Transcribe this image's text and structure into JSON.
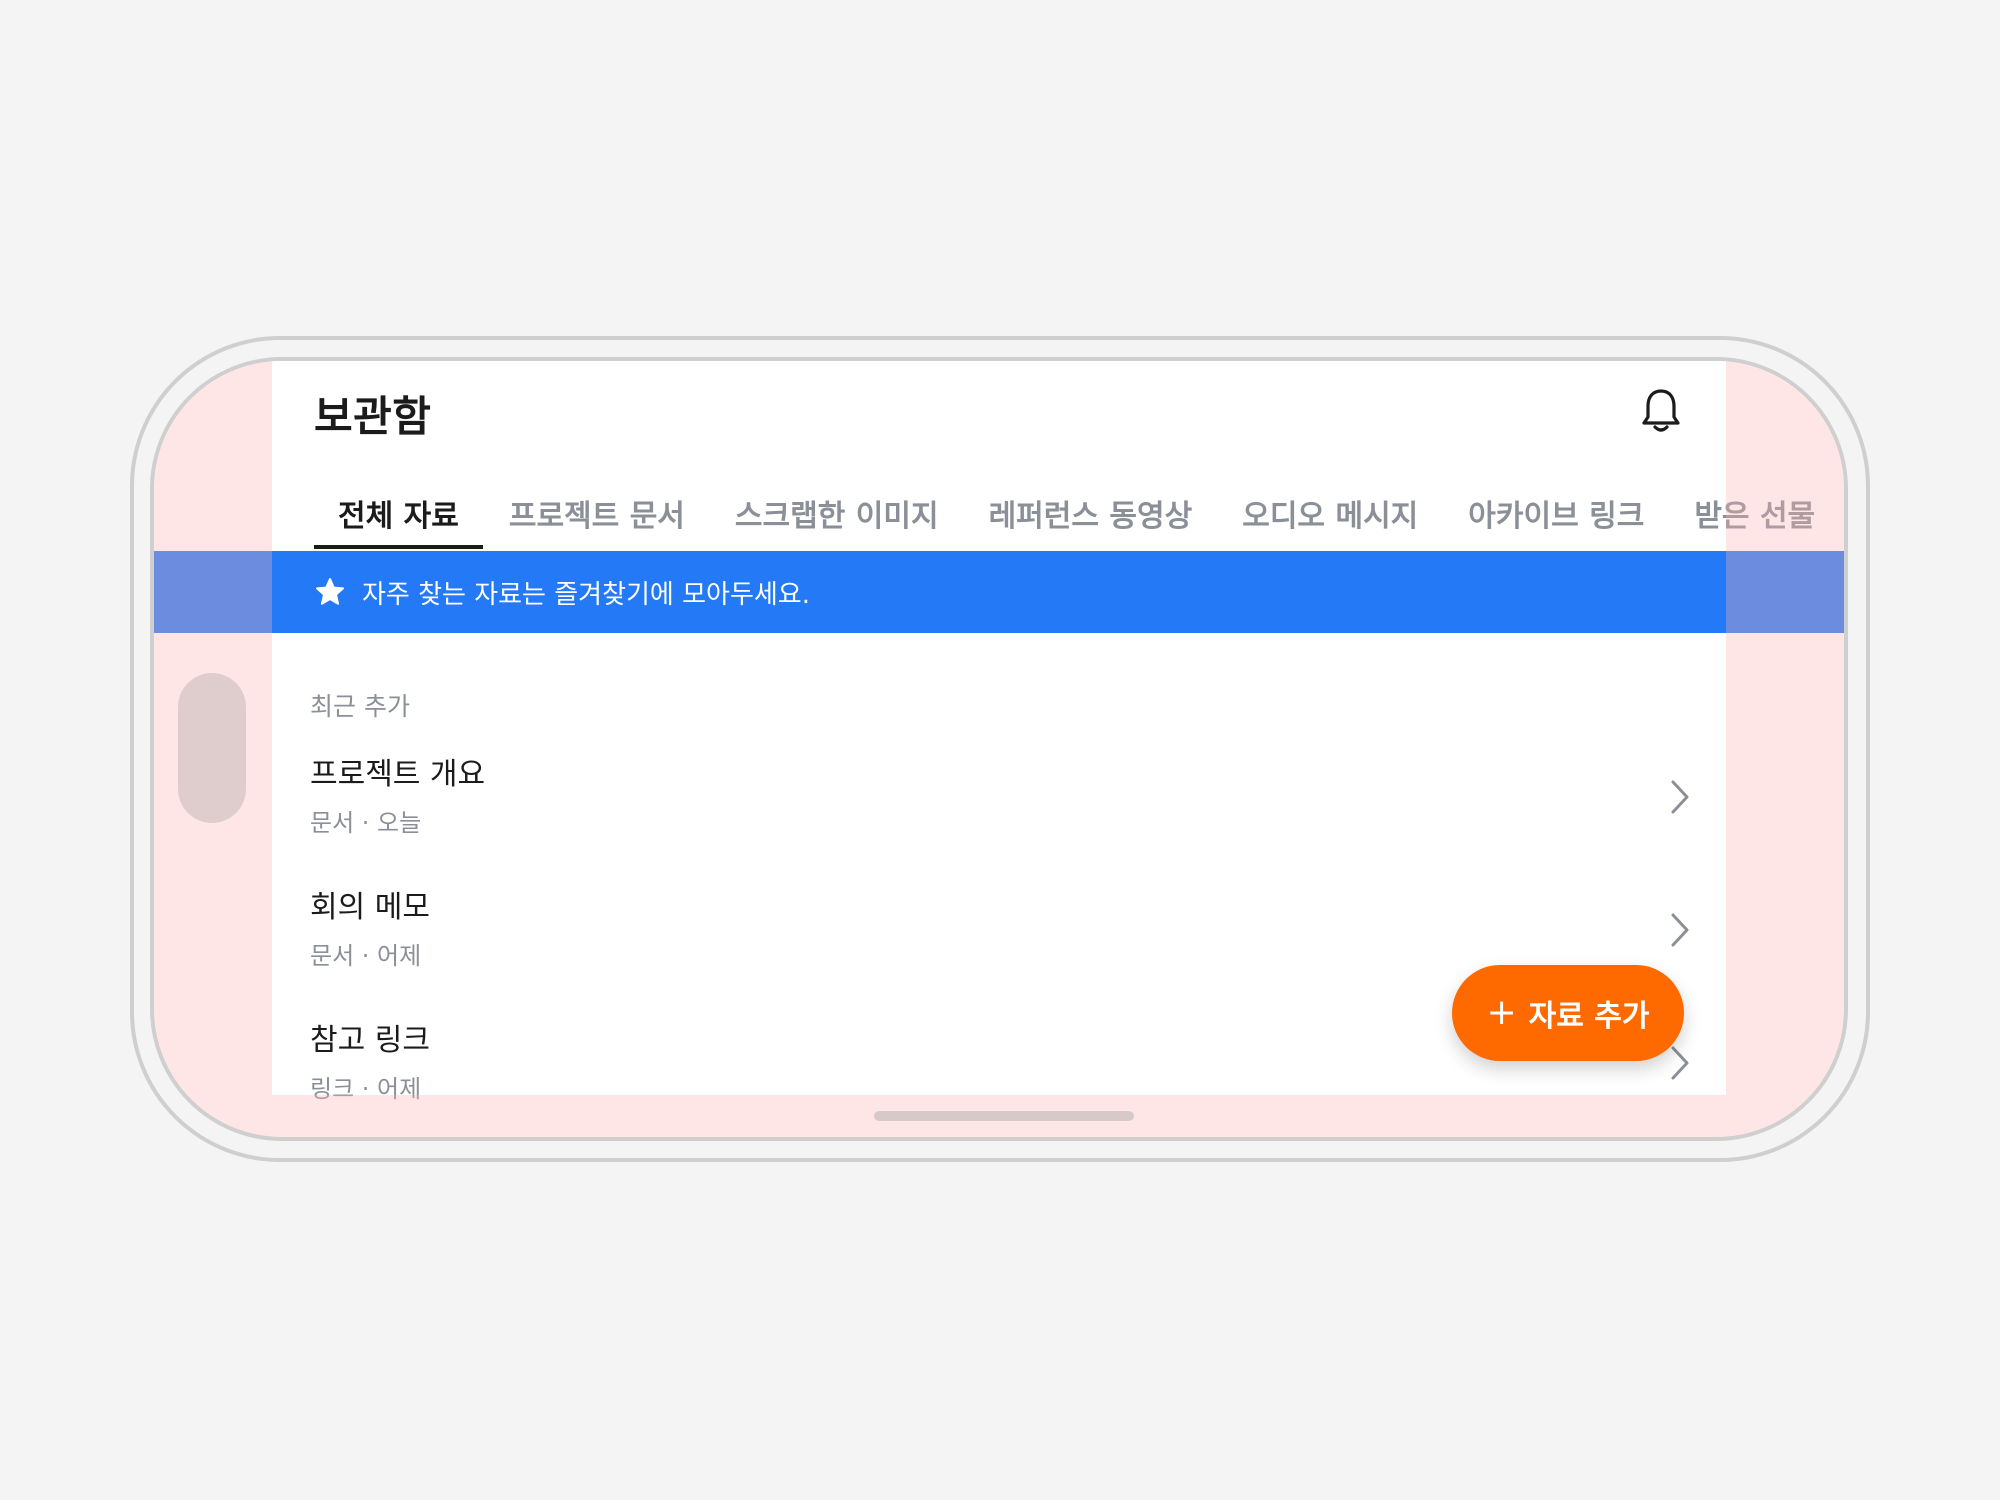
{
  "header": {
    "title": "보관함",
    "notifications_icon": "bell-icon"
  },
  "tabs": [
    {
      "label": "전체 자료",
      "active": true
    },
    {
      "label": "프로젝트 문서",
      "active": false
    },
    {
      "label": "스크랩한 이미지",
      "active": false
    },
    {
      "label": "레퍼런스 동영상",
      "active": false
    },
    {
      "label": "오디오 메시지",
      "active": false
    },
    {
      "label": "아카이브 링크",
      "active": false
    },
    {
      "label": "받은 선물",
      "active": false
    }
  ],
  "banner": {
    "icon": "star-icon",
    "text": "자주 찾는 자료는 즐겨찾기에 모아두세요.",
    "color": "#2479f6"
  },
  "recent": {
    "section_label": "최근 추가",
    "items": [
      {
        "title": "프로젝트 개요",
        "meta": "문서 · 오늘"
      },
      {
        "title": "회의 메모",
        "meta": "문서 · 어제"
      },
      {
        "title": "참고 링크",
        "meta": "링크 · 어제"
      }
    ]
  },
  "fab": {
    "label": "자료 추가",
    "icon": "plus-icon",
    "color": "#ff6a00"
  }
}
